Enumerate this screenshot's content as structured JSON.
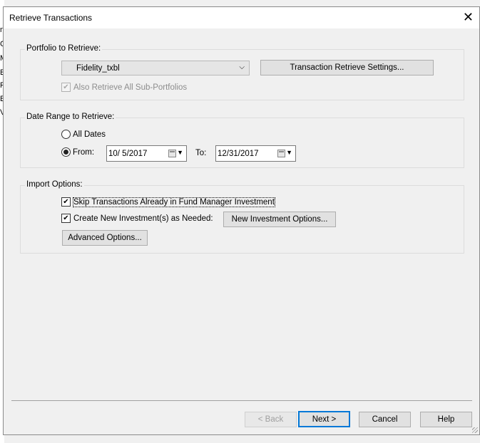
{
  "background": {
    "chars": [
      "",
      "n",
      "C",
      "M",
      "E",
      "R",
      "E",
      "V"
    ]
  },
  "dialog": {
    "title": "Retrieve Transactions",
    "close_icon": "close-icon"
  },
  "portfolio": {
    "legend": "Portfolio to Retrieve:",
    "selected": "Fidelity_txbl",
    "settings_button": "Transaction Retrieve Settings...",
    "sub_portfolios_label": "Also Retrieve All Sub-Portfolios",
    "sub_portfolios_checked": true,
    "sub_portfolios_enabled": false
  },
  "date_range": {
    "legend": "Date Range to Retrieve:",
    "all_dates_label": "All Dates",
    "from_label": "From:",
    "from_value": "10/  5/2017",
    "to_label": "To:",
    "to_value": "12/31/2017",
    "selected_option": "From"
  },
  "import_options": {
    "legend": "Import Options:",
    "skip_label": "Skip Transactions Already in Fund Manager Investment",
    "skip_checked": true,
    "create_label": "Create New Investment(s) as Needed:",
    "create_checked": true,
    "new_investment_button": "New Investment Options...",
    "advanced_button": "Advanced Options..."
  },
  "footer": {
    "back": "< Back",
    "next": "Next >",
    "cancel": "Cancel",
    "help": "Help"
  },
  "colors": {
    "focus_border": "#0078d7",
    "dialog_bg": "#f0f0f0"
  }
}
